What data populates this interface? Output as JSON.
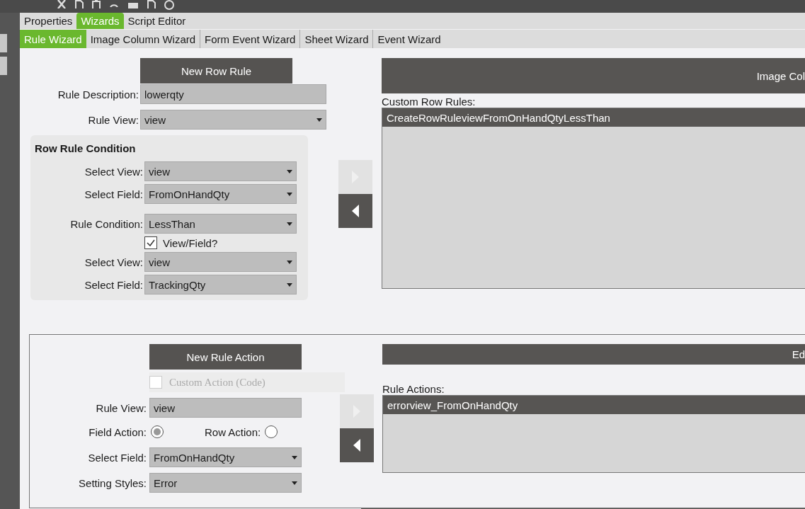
{
  "main_tabs": [
    {
      "label": "Properties",
      "selected": false
    },
    {
      "label": "Wizards",
      "selected": true
    },
    {
      "label": "Script Editor",
      "selected": false
    }
  ],
  "sub_tabs": [
    {
      "label": "Rule Wizard",
      "selected": true
    },
    {
      "label": "Image Column Wizard",
      "selected": false
    },
    {
      "label": "Form Event Wizard",
      "selected": false
    },
    {
      "label": "Sheet Wizard",
      "selected": false
    },
    {
      "label": "Event Wizard",
      "selected": false
    }
  ],
  "row_rule": {
    "new_button": "New Row Rule",
    "description_label": "Rule Description:",
    "description": "lowerqty",
    "view_label": "Rule View:",
    "view": "view",
    "condition": {
      "title": "Row Rule Condition",
      "fields": [
        {
          "kind": "select",
          "label": "Select View:",
          "value": "view"
        },
        {
          "kind": "select",
          "label": "Select Field:",
          "value": "FromOnHandQty"
        },
        {
          "kind": "select",
          "label": "Rule Condition:",
          "value": "LessThan"
        },
        {
          "kind": "checkbox",
          "label": "View/Field?",
          "checked": true
        },
        {
          "kind": "select",
          "label": "Select View:",
          "value": "view"
        },
        {
          "kind": "select",
          "label": "Select Field:",
          "value": "TrackingQty"
        }
      ]
    },
    "arrows": [
      {
        "kind": "right",
        "disabled": true
      },
      {
        "kind": "left",
        "disabled": false
      }
    ]
  },
  "image_panel": {
    "header": "Image Col",
    "list_label": "Custom Row Rules:",
    "items": [
      {
        "label": "CreateRowRuleviewFromOnHandQtyLessThan",
        "selected": true
      }
    ]
  },
  "rule_action": {
    "new_button": "New Rule Action",
    "custom_action": {
      "label": "Custom Action (Code)",
      "checked": false,
      "disabled": true
    },
    "view_label": "Rule View:",
    "view": "view",
    "field_action": {
      "label": "Field Action:",
      "selected": true
    },
    "row_action": {
      "label": "Row Action:",
      "selected": false
    },
    "fields": [
      {
        "label": "Select Field:",
        "value": "FromOnHandQty"
      },
      {
        "label": "Setting Styles:",
        "value": "Error"
      }
    ],
    "arrows": [
      {
        "kind": "right",
        "disabled": true
      },
      {
        "kind": "left",
        "disabled": false
      }
    ]
  },
  "edit_panel": {
    "header": "Ed",
    "list_label": "Rule Actions:",
    "items": [
      {
        "label": "errorview_FromOnHandQty",
        "selected": true
      }
    ]
  }
}
